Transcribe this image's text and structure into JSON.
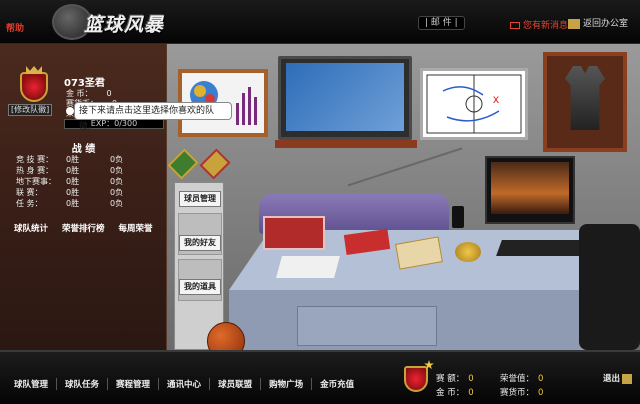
{
  "header": {
    "help": "帮助",
    "logo_text": "篮球风暴",
    "nav_pill": "| 邮 件 |",
    "mail": "您有新消息",
    "office": "返回办公室"
  },
  "player": {
    "edit_badge": "[修改队徽]",
    "name": "073圣君",
    "stats": [
      {
        "label": "金    币：",
        "value": "0"
      },
      {
        "label": "赛货币：",
        "value": "0"
      },
      {
        "label": "荣    誉：",
        "value": "0"
      }
    ],
    "exp": "EXP：0/300",
    "exp_fraction": 0
  },
  "tooltip": "接下来请点击这里选择你喜欢的队徽。",
  "record": {
    "title": "战  绩",
    "rows": [
      {
        "label": "竞  技  赛：",
        "wins": "0胜",
        "losses": "0负"
      },
      {
        "label": "热  身  赛：",
        "wins": "0胜",
        "losses": "0负"
      },
      {
        "label": "地下赛事：",
        "wins": "0胜",
        "losses": "0负"
      },
      {
        "label": "联        赛：",
        "wins": "0胜",
        "losses": "0负"
      },
      {
        "label": "任        务：",
        "wins": "0胜",
        "losses": "0负"
      }
    ],
    "links": [
      "球队统计",
      "荣誉排行榜",
      "每周荣誉"
    ]
  },
  "cabinet": {
    "buttons": [
      "球员管理",
      "我的好友",
      "我的道具"
    ]
  },
  "bottom": {
    "nav": [
      "球队管理",
      "球队任务",
      "赛程管理",
      "通讯中心",
      "球员联盟",
      "购物广场",
      "金币充值"
    ],
    "currency": [
      {
        "label": "赛    额：",
        "value": "0"
      },
      {
        "label": "金    币：",
        "value": "0"
      },
      {
        "label": "荣誉值：",
        "value": "0"
      },
      {
        "label": "赛货币：",
        "value": "0"
      }
    ],
    "exit": "退出"
  },
  "colors": {
    "accent_red": "#e23b2b",
    "gold": "#f0c84a",
    "panel_brown": "#3b2018"
  }
}
